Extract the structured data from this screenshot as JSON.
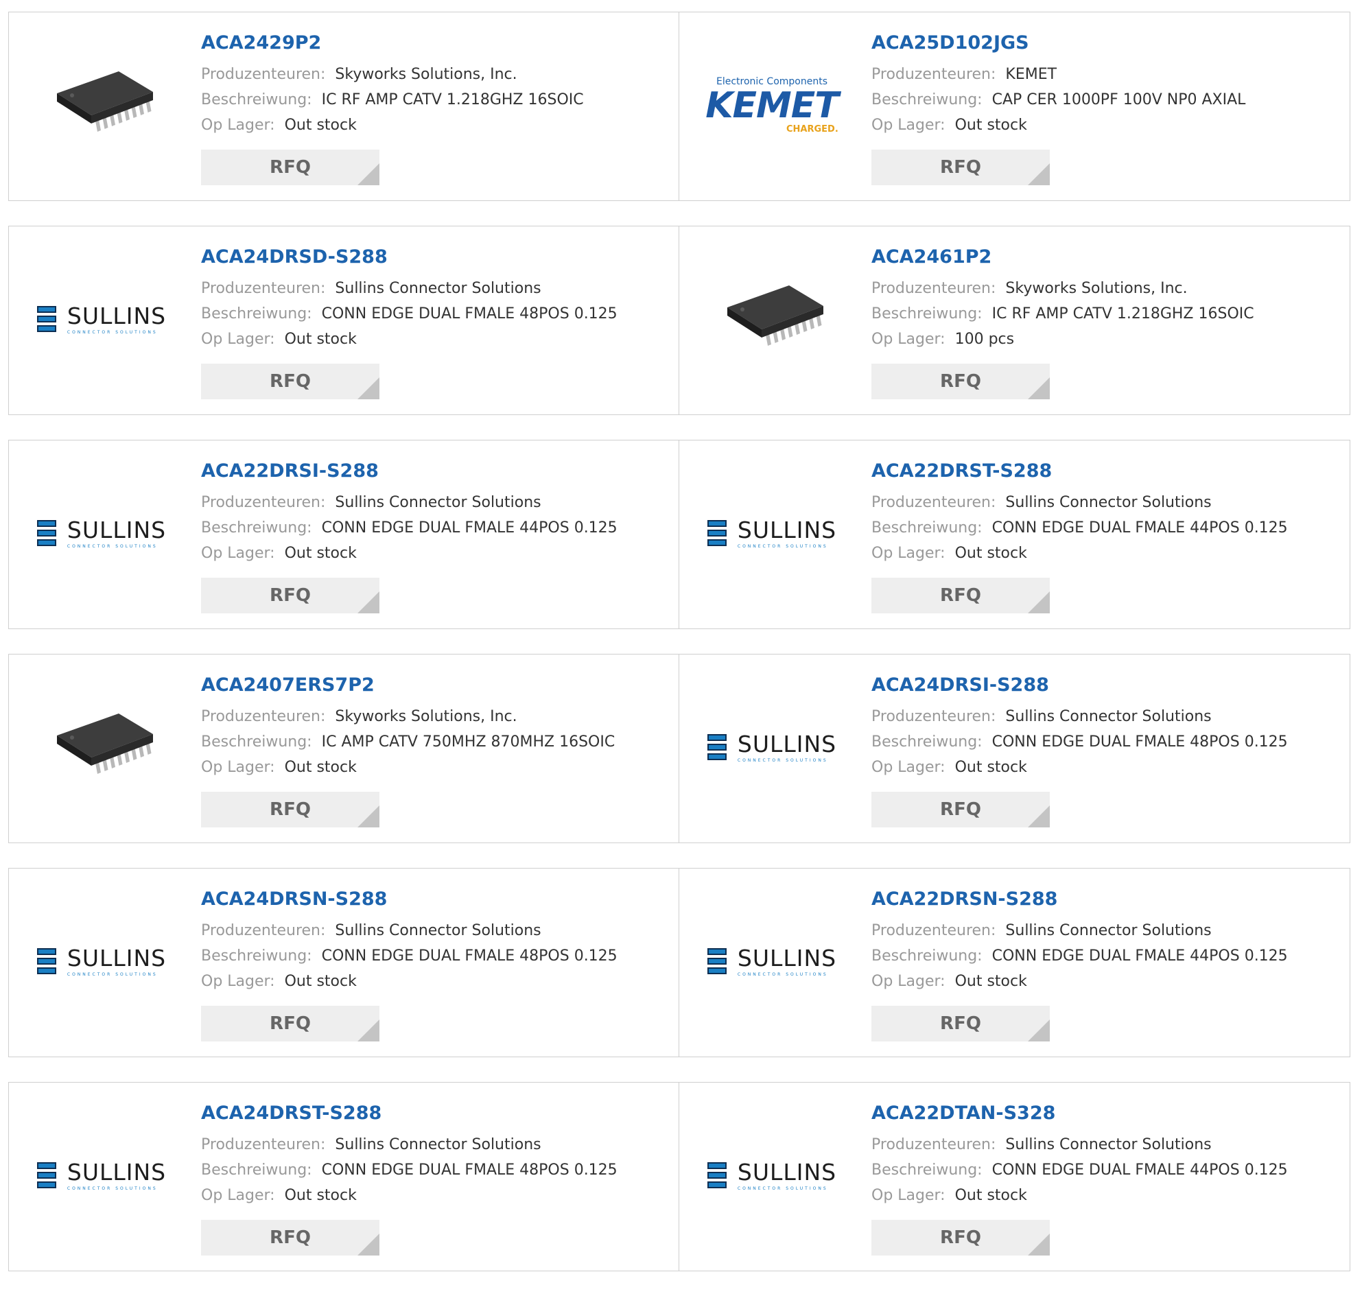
{
  "labels": {
    "manufacturer": "Produzenteuren:",
    "description": "Beschreiwung:",
    "stock": "Op Lager:",
    "rfq": "RFQ"
  },
  "logos": {
    "sullins_word": "SULLINS",
    "sullins_sub": "CONNECTOR SOLUTIONS",
    "kemet_top": "Electronic Components",
    "kemet_main": "KEMET",
    "kemet_charged": "CHARGED."
  },
  "products": [
    {
      "part": "ACA2429P2",
      "manufacturer": "Skyworks Solutions, Inc.",
      "description": "IC RF AMP CATV 1.218GHZ 16SOIC",
      "stock": "Out stock",
      "image": "chip-icon"
    },
    {
      "part": "ACA25D102JGS",
      "manufacturer": "KEMET",
      "description": "CAP CER 1000PF 100V NP0 AXIAL",
      "stock": "Out stock",
      "image": "kemet-logo"
    },
    {
      "part": "ACA24DRSD-S288",
      "manufacturer": "Sullins Connector Solutions",
      "description": "CONN EDGE DUAL FMALE 48POS 0.125",
      "stock": "Out stock",
      "image": "sullins-logo"
    },
    {
      "part": "ACA2461P2",
      "manufacturer": "Skyworks Solutions, Inc.",
      "description": "IC RF AMP CATV 1.218GHZ 16SOIC",
      "stock": "100 pcs",
      "image": "chip-icon"
    },
    {
      "part": "ACA22DRSI-S288",
      "manufacturer": "Sullins Connector Solutions",
      "description": "CONN EDGE DUAL FMALE 44POS 0.125",
      "stock": "Out stock",
      "image": "sullins-logo"
    },
    {
      "part": "ACA22DRST-S288",
      "manufacturer": "Sullins Connector Solutions",
      "description": "CONN EDGE DUAL FMALE 44POS 0.125",
      "stock": "Out stock",
      "image": "sullins-logo"
    },
    {
      "part": "ACA2407ERS7P2",
      "manufacturer": "Skyworks Solutions, Inc.",
      "description": "IC AMP CATV 750MHZ 870MHZ 16SOIC",
      "stock": "Out stock",
      "image": "chip-icon"
    },
    {
      "part": "ACA24DRSI-S288",
      "manufacturer": "Sullins Connector Solutions",
      "description": "CONN EDGE DUAL FMALE 48POS 0.125",
      "stock": "Out stock",
      "image": "sullins-logo"
    },
    {
      "part": "ACA24DRSN-S288",
      "manufacturer": "Sullins Connector Solutions",
      "description": "CONN EDGE DUAL FMALE 48POS 0.125",
      "stock": "Out stock",
      "image": "sullins-logo"
    },
    {
      "part": "ACA22DRSN-S288",
      "manufacturer": "Sullins Connector Solutions",
      "description": "CONN EDGE DUAL FMALE 44POS 0.125",
      "stock": "Out stock",
      "image": "sullins-logo"
    },
    {
      "part": "ACA24DRST-S288",
      "manufacturer": "Sullins Connector Solutions",
      "description": "CONN EDGE DUAL FMALE 48POS 0.125",
      "stock": "Out stock",
      "image": "sullins-logo"
    },
    {
      "part": "ACA22DTAN-S328",
      "manufacturer": "Sullins Connector Solutions",
      "description": "CONN EDGE DUAL FMALE 44POS 0.125",
      "stock": "Out stock",
      "image": "sullins-logo"
    }
  ]
}
